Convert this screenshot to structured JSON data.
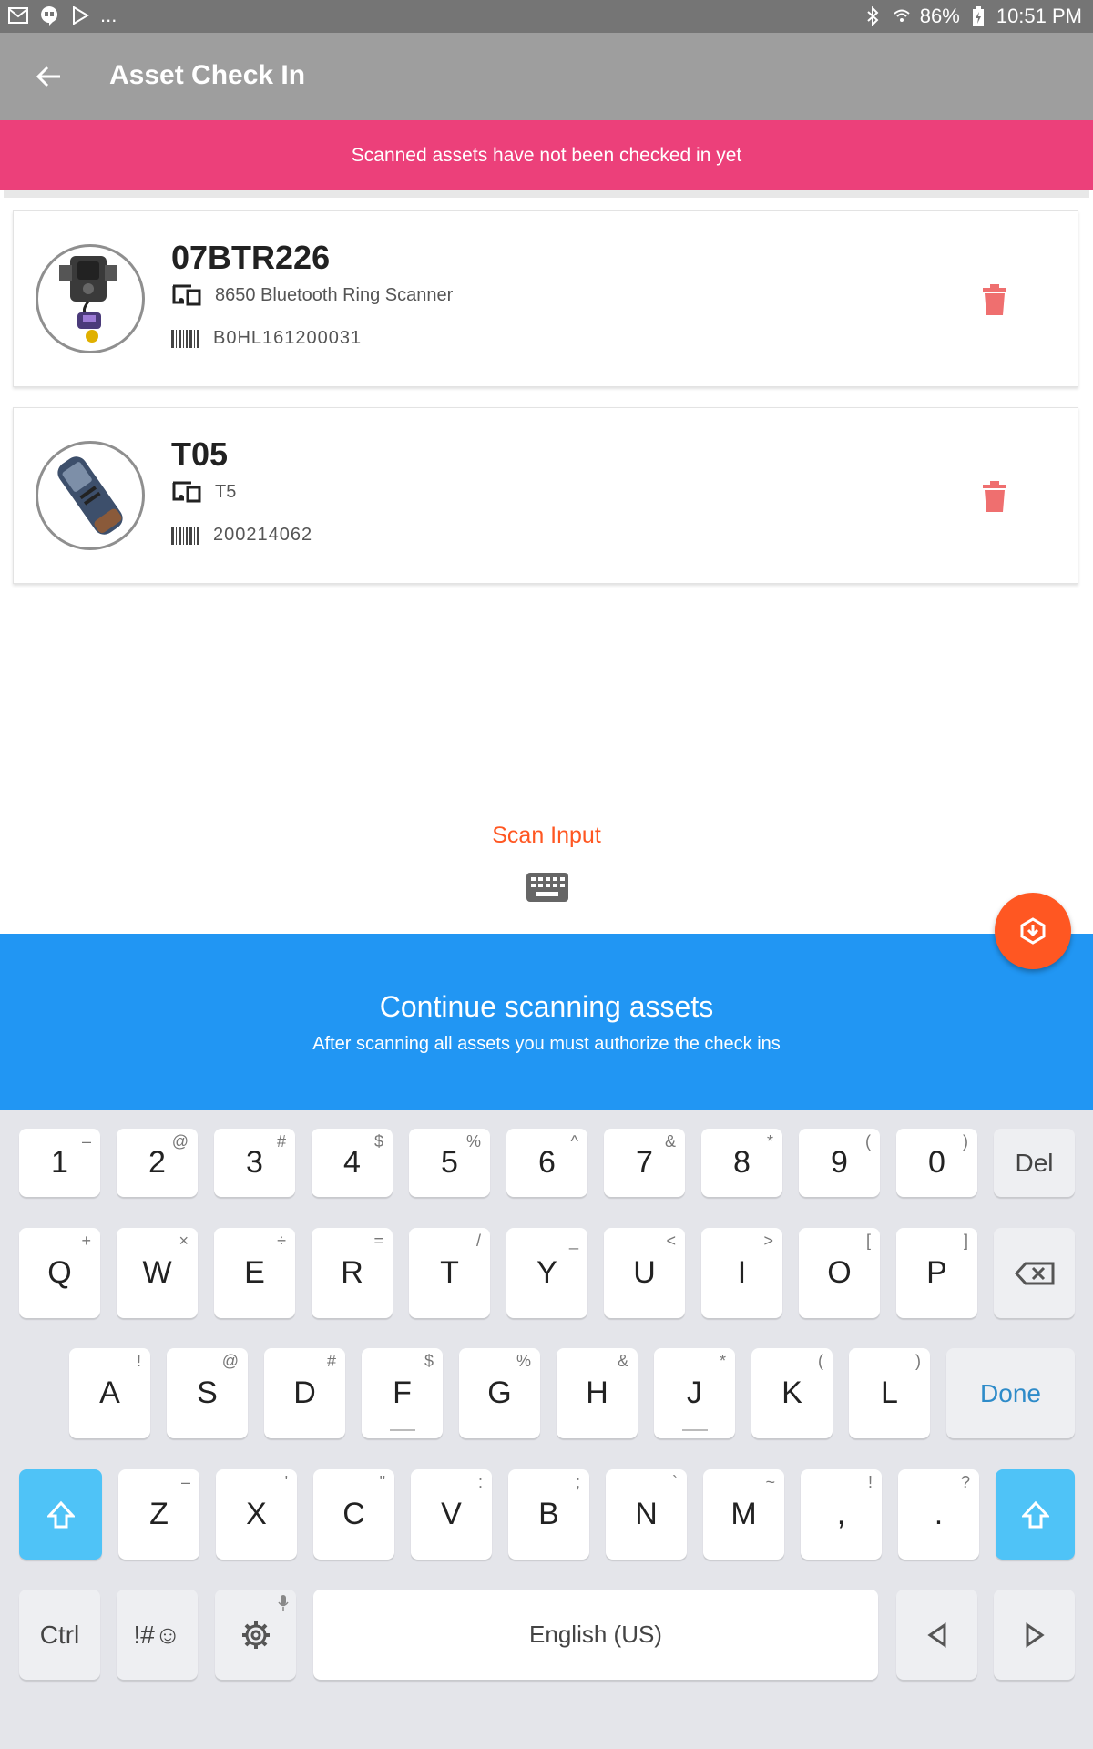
{
  "status_bar": {
    "left_more": "...",
    "battery": "86%",
    "time": "10:51 PM"
  },
  "app_bar": {
    "title": "Asset Check In"
  },
  "banner": {
    "text": "Scanned assets have not been checked in yet"
  },
  "assets": [
    {
      "name": "07BTR226",
      "model": "8650 Bluetooth Ring Scanner",
      "serial": "B0HL161200031"
    },
    {
      "name": "T05",
      "model": "T5",
      "serial": "200214062"
    }
  ],
  "scan_input": {
    "label": "Scan Input"
  },
  "panel": {
    "heading": "Continue scanning assets",
    "subtext": "After scanning all assets you must authorize the check ins"
  },
  "keyboard": {
    "row1": [
      {
        "k": "1",
        "h": "–"
      },
      {
        "k": "2",
        "h": "@"
      },
      {
        "k": "3",
        "h": "#"
      },
      {
        "k": "4",
        "h": "$"
      },
      {
        "k": "5",
        "h": "%"
      },
      {
        "k": "6",
        "h": "^"
      },
      {
        "k": "7",
        "h": "&"
      },
      {
        "k": "8",
        "h": "*"
      },
      {
        "k": "9",
        "h": "("
      },
      {
        "k": "0",
        "h": ")"
      }
    ],
    "del": "Del",
    "row2": [
      {
        "k": "Q",
        "h": "+"
      },
      {
        "k": "W",
        "h": "×"
      },
      {
        "k": "E",
        "h": "÷"
      },
      {
        "k": "R",
        "h": "="
      },
      {
        "k": "T",
        "h": "/"
      },
      {
        "k": "Y",
        "h": "_"
      },
      {
        "k": "U",
        "h": "<"
      },
      {
        "k": "I",
        "h": ">"
      },
      {
        "k": "O",
        "h": "["
      },
      {
        "k": "P",
        "h": "]"
      }
    ],
    "row3": [
      {
        "k": "A",
        "h": "!"
      },
      {
        "k": "S",
        "h": "@"
      },
      {
        "k": "D",
        "h": "#"
      },
      {
        "k": "F",
        "h": "$"
      },
      {
        "k": "G",
        "h": "%"
      },
      {
        "k": "H",
        "h": "&"
      },
      {
        "k": "J",
        "h": "*"
      },
      {
        "k": "K",
        "h": "("
      },
      {
        "k": "L",
        "h": ")"
      }
    ],
    "done": "Done",
    "row4": [
      {
        "k": "Z",
        "h": "–"
      },
      {
        "k": "X",
        "h": "'"
      },
      {
        "k": "C",
        "h": "\""
      },
      {
        "k": "V",
        "h": ":"
      },
      {
        "k": "B",
        "h": ";"
      },
      {
        "k": "N",
        "h": "`"
      },
      {
        "k": "M",
        "h": "~"
      },
      {
        "k": ",",
        "h": "!"
      },
      {
        "k": ".",
        "h": "?"
      }
    ],
    "ctrl": "Ctrl",
    "symbols": "!#☺",
    "space": "English (US)"
  },
  "colors": {
    "banner": "#ec407a",
    "accent": "#ff5722",
    "panel": "#2196f3",
    "trash": "#ef6f6f",
    "shift": "#4fc3f7"
  }
}
